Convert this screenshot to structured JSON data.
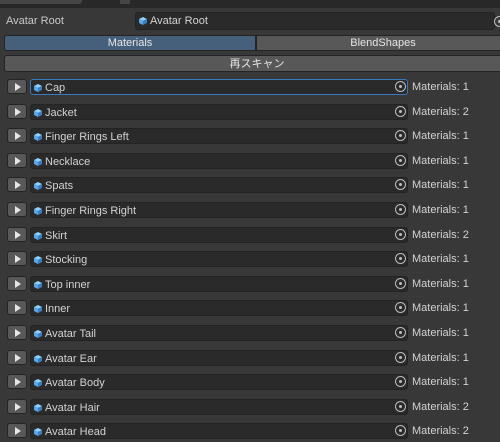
{
  "header": {
    "root_label": "Avatar Root",
    "root_value": "Avatar Root"
  },
  "tabs": [
    {
      "label": "Materials",
      "active": true
    },
    {
      "label": "BlendShapes",
      "active": false
    }
  ],
  "rescan_label": "再スキャン",
  "items": [
    {
      "name": "Cap",
      "materials": "Materials: 1"
    },
    {
      "name": "Jacket",
      "materials": "Materials: 2"
    },
    {
      "name": "Finger Rings Left",
      "materials": "Materials: 1"
    },
    {
      "name": "Necklace",
      "materials": "Materials: 1"
    },
    {
      "name": "Spats",
      "materials": "Materials: 1"
    },
    {
      "name": "Finger Rings Right",
      "materials": "Materials: 1"
    },
    {
      "name": "Skirt",
      "materials": "Materials: 2"
    },
    {
      "name": "Stocking",
      "materials": "Materials: 1"
    },
    {
      "name": "Top inner",
      "materials": "Materials: 1"
    },
    {
      "name": "Inner",
      "materials": "Materials: 1"
    },
    {
      "name": "Avatar Tail",
      "materials": "Materials: 1"
    },
    {
      "name": "Avatar Ear",
      "materials": "Materials: 1"
    },
    {
      "name": "Avatar Body",
      "materials": "Materials: 1"
    },
    {
      "name": "Avatar Hair",
      "materials": "Materials: 2"
    },
    {
      "name": "Avatar Head",
      "materials": "Materials: 2"
    }
  ],
  "colors": {
    "background": "#383838",
    "active_tab": "#46607c",
    "field": "#2a2a2a",
    "cube_icon": "#5aa7e6"
  }
}
